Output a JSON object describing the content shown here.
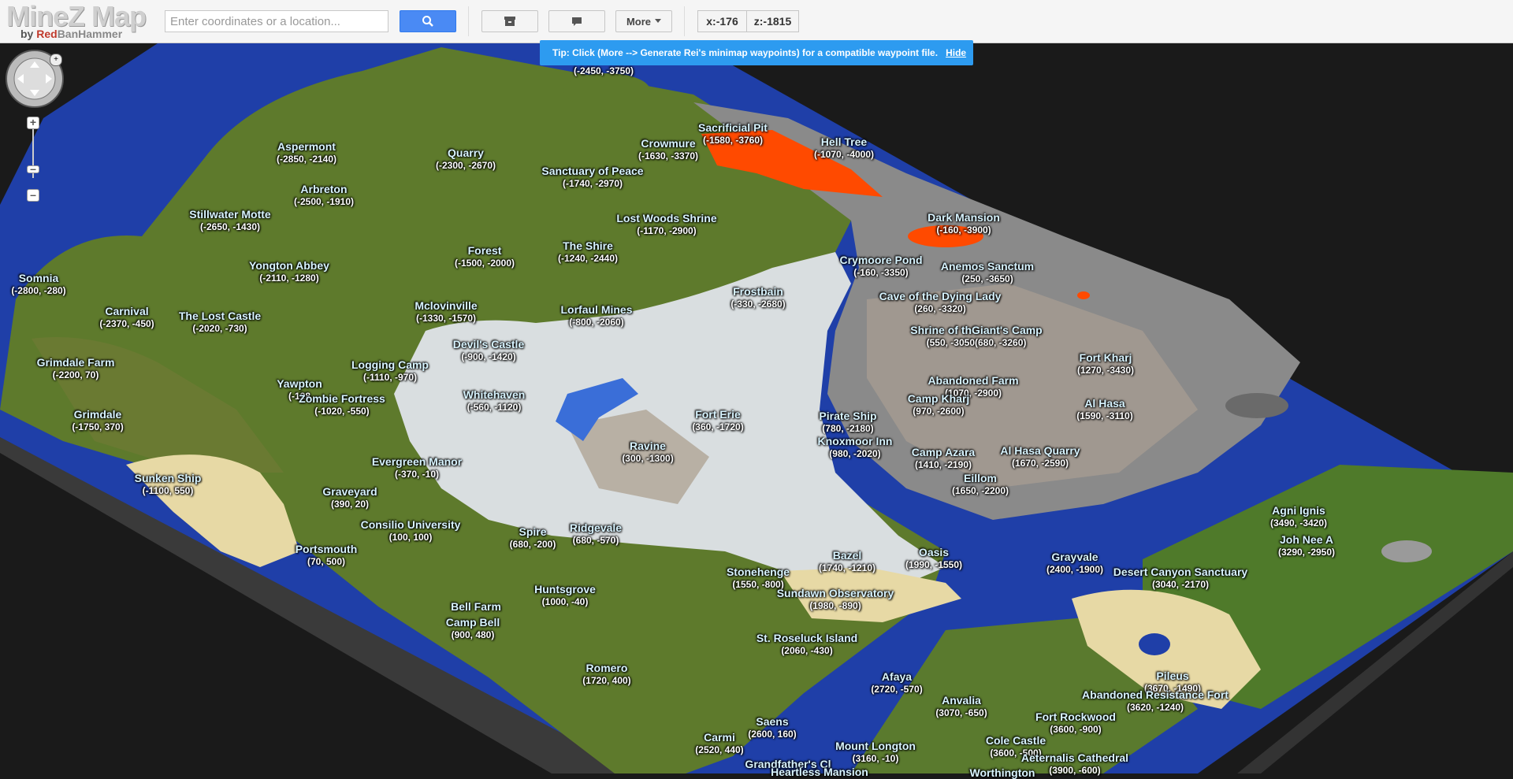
{
  "app": {
    "title": "MineZ Map",
    "byline_prefix": "by ",
    "byline_red": "Red",
    "byline_rest": "BanHammer"
  },
  "search": {
    "placeholder": "Enter coordinates or a location..."
  },
  "toolbar": {
    "more_label": "More",
    "x_readout": "x:-176",
    "z_readout": "z:-1815"
  },
  "tip": {
    "text": "Tip: Click (More --> Generate Rei's minimap waypoints) for a compatible waypoint file.",
    "hide_label": "Hide"
  },
  "colors": {
    "water": "#1f3fa8",
    "grass": "#5e7a2c",
    "snow": "#d9dee0",
    "sand": "#e7d9a5",
    "lava": "#ff4a00",
    "rock": "#8a8a8a",
    "tip_bg": "#2d9bf0"
  },
  "labels": [
    {
      "name": "",
      "coords": "(-2450, -3750)"
    },
    {
      "name": "Sacrificial Pit",
      "coords": "(-1580, -3760)"
    },
    {
      "name": "Hell Tree",
      "coords": "(-1070, -4000)"
    },
    {
      "name": "Crowmure",
      "coords": "(-1630, -3370)"
    },
    {
      "name": "Aspermont",
      "coords": "(-2850, -2140)"
    },
    {
      "name": "Quarry",
      "coords": "(-2300, -2670)"
    },
    {
      "name": "Sanctuary of Peace",
      "coords": "(-1740, -2970)"
    },
    {
      "name": "Arbreton",
      "coords": "(-2500, -1910)"
    },
    {
      "name": "Stillwater Motte",
      "coords": "(-2650, -1430)"
    },
    {
      "name": "Lost Woods Shrine",
      "coords": "(-1170, -2900)"
    },
    {
      "name": "Dark Mansion",
      "coords": "(-160, -3900)"
    },
    {
      "name": "Forest",
      "coords": "(-1500, -2000)"
    },
    {
      "name": "The Shire",
      "coords": "(-1240, -2440)"
    },
    {
      "name": "Yongton Abbey",
      "coords": "(-2110, -1280)"
    },
    {
      "name": "Crymoore Pond",
      "coords": "(-160, -3350)"
    },
    {
      "name": "Anemos Sanctum",
      "coords": "(250, -3650)"
    },
    {
      "name": "Somnia",
      "coords": "(-2800, -280)"
    },
    {
      "name": "Frostbain",
      "coords": "(-330, -2680)"
    },
    {
      "name": "Cave of the Dying Lady",
      "coords": "(260, -3320)"
    },
    {
      "name": "Carnival",
      "coords": "(-2370, -450)"
    },
    {
      "name": "The Lost Castle",
      "coords": "(-2020, -730)"
    },
    {
      "name": "Mclovinville",
      "coords": "(-1330, -1570)"
    },
    {
      "name": "Lorfaul Mines",
      "coords": "(-800, -2060)"
    },
    {
      "name": "Shrine of thGiant's Camp",
      "coords": "(550, -3050(680, -3260)"
    },
    {
      "name": "Devil's Castle",
      "coords": "(-900, -1420)"
    },
    {
      "name": "Grimdale Farm",
      "coords": "(-2200, 70)"
    },
    {
      "name": "Logging Camp",
      "coords": "(-1110, -970)"
    },
    {
      "name": "Fort Kharj",
      "coords": "(1270, -3430)"
    },
    {
      "name": "Abandoned Farm",
      "coords": "(1070, -2900)"
    },
    {
      "name": "Yawpton",
      "coords": "(-128"
    },
    {
      "name": "Zombie Fortress",
      "coords": "(-1020, -550)"
    },
    {
      "name": "Whitehaven",
      "coords": "(-560, -1120)"
    },
    {
      "name": "Camp Kharj",
      "coords": "(970, -2600)"
    },
    {
      "name": "Al Hasa",
      "coords": "(1590, -3110)"
    },
    {
      "name": "Grimdale",
      "coords": "(-1750, 370)"
    },
    {
      "name": "Fort Erie",
      "coords": "(360, -1720)"
    },
    {
      "name": "Pirate Ship",
      "coords": "(780, -2180)"
    },
    {
      "name": "Knoxmoor Inn",
      "coords": "(980, -2020)"
    },
    {
      "name": "Ravine",
      "coords": "(300, -1300)"
    },
    {
      "name": "Camp Azara",
      "coords": "(1410, -2190)"
    },
    {
      "name": "Al Hasa Quarry",
      "coords": "(1670, -2590)"
    },
    {
      "name": "Evergreen Manor",
      "coords": "(-370, -10)"
    },
    {
      "name": "Sunken Ship",
      "coords": "(-1100, 550)"
    },
    {
      "name": "Eillom",
      "coords": "(1650, -2200)"
    },
    {
      "name": "Graveyard",
      "coords": "(390, 20)"
    },
    {
      "name": "Agni Ignis",
      "coords": "(3490, -3420)"
    },
    {
      "name": "Consilio University",
      "coords": "(100, 100)"
    },
    {
      "name": "Ridgevale",
      "coords": "(680, -570)"
    },
    {
      "name": "Spire",
      "coords": "(680, -200)"
    },
    {
      "name": "Joh Nee A",
      "coords": "(3290, -2950)"
    },
    {
      "name": "Portsmouth",
      "coords": "(70, 500)"
    },
    {
      "name": "Oasis",
      "coords": "(1990, -1550)"
    },
    {
      "name": "Bazel",
      "coords": "(1740, -1210)"
    },
    {
      "name": "Grayvale",
      "coords": "(2400, -1900)"
    },
    {
      "name": "Stonehenge",
      "coords": "(1550, -800)"
    },
    {
      "name": "Desert Canyon Sanctuary",
      "coords": "(3040, -2170)"
    },
    {
      "name": "Huntsgrove",
      "coords": "(1000, -40)"
    },
    {
      "name": "Sundawn Observatory",
      "coords": "(1980, -890)"
    },
    {
      "name": "Bell Farm",
      "coords": ""
    },
    {
      "name": "Camp Bell",
      "coords": "(900, 480)"
    },
    {
      "name": "St. Roseluck Island",
      "coords": "(2060, -430)"
    },
    {
      "name": "Romero",
      "coords": "(1720, 400)"
    },
    {
      "name": "Pileus",
      "coords": "(3670, -1490)"
    },
    {
      "name": "Afaya",
      "coords": "(2720, -570)"
    },
    {
      "name": "Abandoned Resistance Fort",
      "coords": "(3620, -1240)"
    },
    {
      "name": "Anvalia",
      "coords": "(3070, -650)"
    },
    {
      "name": "Fort Rockwood",
      "coords": "(3600, -900)"
    },
    {
      "name": "Saens",
      "coords": "(2600, 160)"
    },
    {
      "name": "Carmi",
      "coords": "(2520, 440)"
    },
    {
      "name": "Mount Longton",
      "coords": "(3160, -10)"
    },
    {
      "name": "Cole Castle",
      "coords": "(3600, -500)"
    },
    {
      "name": "Grandfather's Cl",
      "coords": ""
    },
    {
      "name": "Aeternalis Cathedral",
      "coords": "(3900, -600)"
    },
    {
      "name": "Heartless Mansion",
      "coords": ""
    },
    {
      "name": "Worthington",
      "coords": ""
    }
  ]
}
